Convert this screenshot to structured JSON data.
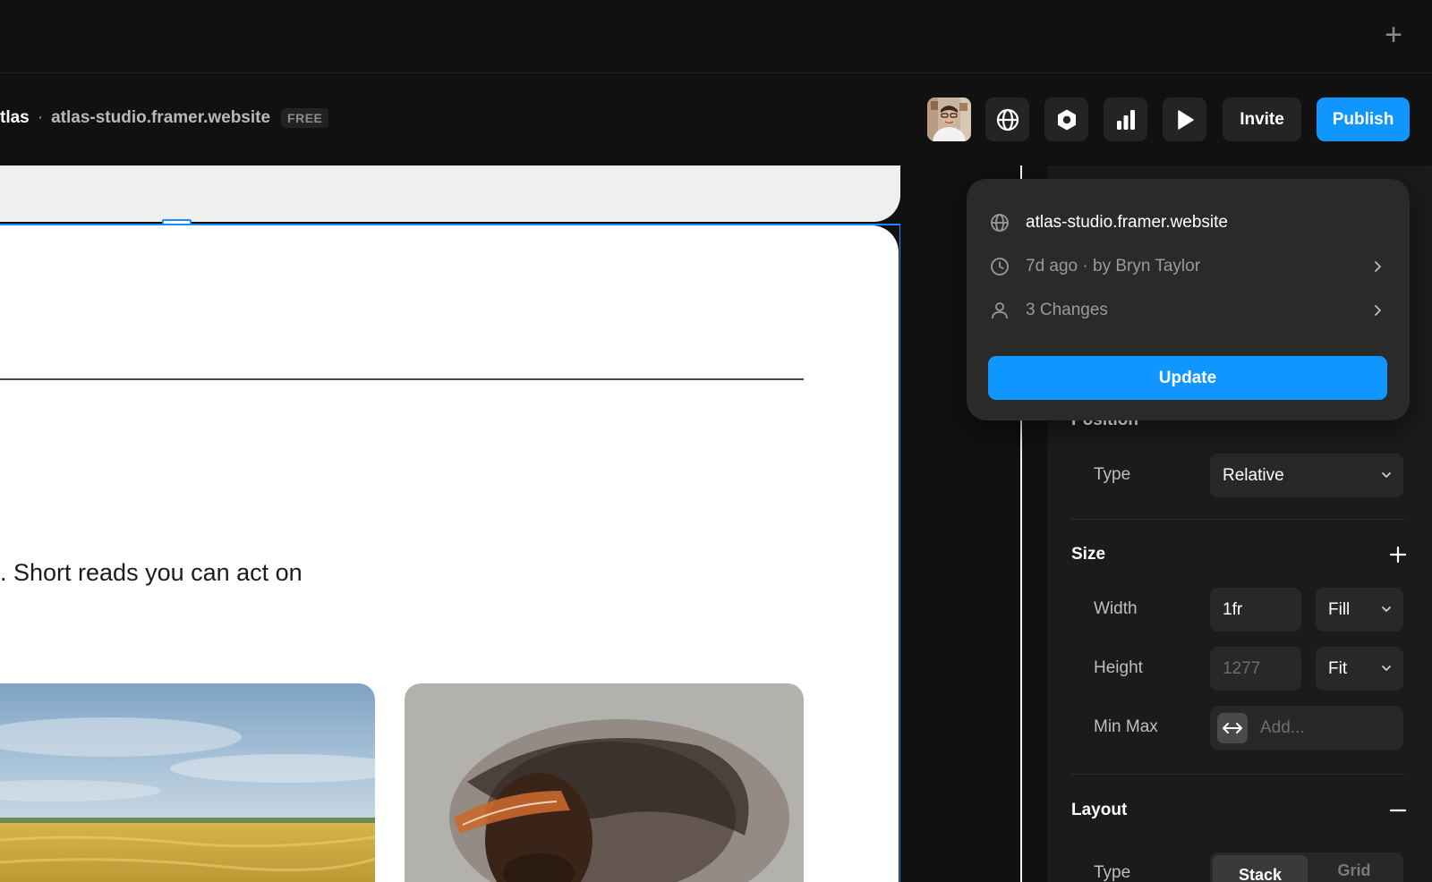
{
  "header": {
    "project_name": "tlas",
    "separator": "·",
    "domain": "atlas-studio.framer.website",
    "plan_badge": "FREE",
    "invite_label": "Invite",
    "publish_label": "Publish",
    "new_tab_symbol": "+"
  },
  "canvas": {
    "tagline": ". Short reads you can act on"
  },
  "publish_popover": {
    "domain": "atlas-studio.framer.website",
    "last_published": "7d ago · by Bryn Taylor",
    "changes": "3 Changes",
    "update_label": "Update"
  },
  "properties": {
    "position": {
      "title": "Position",
      "type_label": "Type",
      "type_value": "Relative"
    },
    "size": {
      "title": "Size",
      "width_label": "Width",
      "width_value": "1fr",
      "width_mode": "Fill",
      "height_label": "Height",
      "height_value": "1277",
      "height_mode": "Fit",
      "minmax_label": "Min Max",
      "minmax_placeholder": "Add..."
    },
    "layout": {
      "title": "Layout",
      "type_label": "Type",
      "options": [
        "Stack",
        "Grid"
      ],
      "selected": "Stack"
    }
  },
  "colors": {
    "accent": "#0f96ff",
    "selection": "#1a8cff",
    "background": "#111111",
    "panel": "#1b1b1b"
  },
  "icons": {
    "toolbar": [
      "globe-icon",
      "hexagon-icon",
      "bar-chart-icon",
      "play-icon"
    ],
    "popover": [
      "globe-icon",
      "clock-icon",
      "user-icon",
      "chevron-right-icon"
    ],
    "panel": [
      "chevron-down-icon",
      "plus-icon",
      "minus-icon",
      "resize-horizontal-icon"
    ]
  }
}
